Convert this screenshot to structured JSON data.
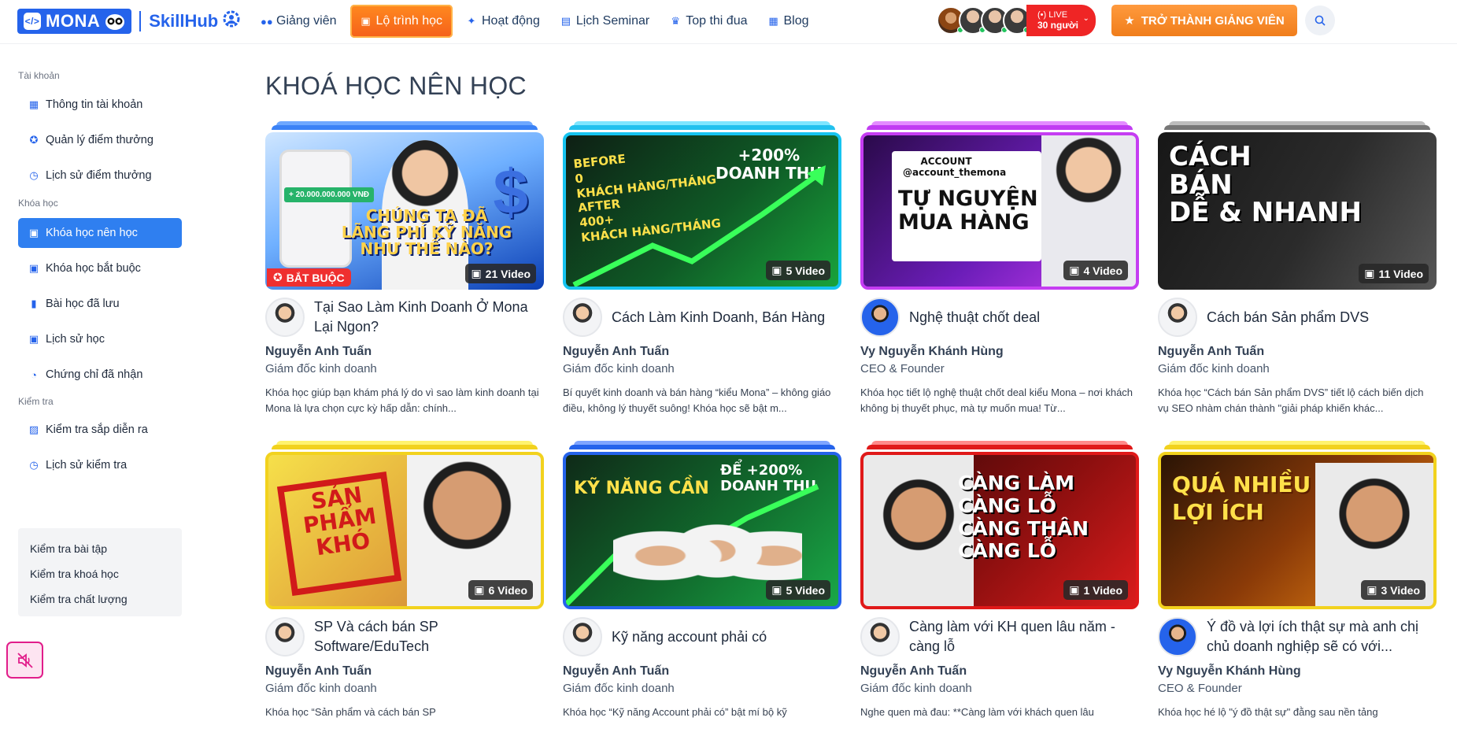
{
  "header": {
    "logo": {
      "brand": "MONA",
      "product": "SkillHub"
    },
    "nav": [
      {
        "label": "Giảng viên",
        "icon": "users-icon"
      },
      {
        "label": "Lộ trình học",
        "icon": "calendar-icon",
        "active": true
      },
      {
        "label": "Hoạt động",
        "icon": "bolt-icon"
      },
      {
        "label": "Lịch Seminar",
        "icon": "seminar-icon"
      },
      {
        "label": "Top thi đua",
        "icon": "trophy-icon"
      },
      {
        "label": "Blog",
        "icon": "blog-icon"
      }
    ],
    "live": {
      "label": "(•) LIVE",
      "count": "30 người"
    },
    "cta": "TRỞ THÀNH GIẢNG VIÊN"
  },
  "sidebar": {
    "sections": [
      {
        "title": "Tài khoản",
        "items": [
          "Thông tin tài khoản",
          "Quản lý điểm thưởng",
          "Lịch sử điểm thưởng"
        ]
      },
      {
        "title": "Khóa học",
        "items": [
          "Khóa học nên học",
          "Khóa học bắt buộc",
          "Bài học đã lưu",
          "Lịch sử học",
          "Chứng chỉ đã nhận"
        ]
      },
      {
        "title": "Kiểm tra",
        "items": [
          "Kiểm tra sắp diễn ra",
          "Lịch sử kiểm tra"
        ]
      }
    ],
    "sub_items": [
      "Kiểm tra bài tập",
      "Kiểm tra khoá học",
      "Kiểm tra chất lượng"
    ]
  },
  "main": {
    "title": "KHOÁ HỌC NÊN HỌC",
    "courses": [
      {
        "title": "Tại Sao Làm Kinh Doanh Ở Mona Lại Ngon?",
        "author": "Nguyễn Anh Tuấn",
        "role": "Giám đốc kinh doanh",
        "desc": "Khóa học giúp bạn khám phá lý do vì sao làm kinh doanh tại Mona là lựa chọn cực kỳ hấp dẫn: chính...",
        "videos": "21 Video",
        "badge": "BẮT BUỘC",
        "thumb_text": "CHÚNG TA ĐÃ\nLÃNG PHÍ KỸ NĂNG\nNHƯ THẾ NÀO?",
        "phone_text": "+ 20.000.000.000 VNĐ"
      },
      {
        "title": "Cách Làm Kinh Doanh, Bán Hàng",
        "author": "Nguyễn Anh Tuấn",
        "role": "Giám đốc kinh doanh",
        "desc": "Bí quyết kinh doanh và bán hàng “kiểu Mona” – không giáo điều, không lý thuyết suông! Khóa học sẽ bật m...",
        "videos": "5 Video",
        "thumb_text": "BEFORE\n0\nKHÁCH HÀNG/THÁNG\nAFTER\n400+\nKHÁCH HÀNG/THÁNG",
        "thumb_text2": "+200%\nDOANH THU"
      },
      {
        "title": "Nghệ thuật chốt deal",
        "author": "Vy Nguyễn Khánh Hùng",
        "role": "CEO & Founder",
        "desc": "Khóa học tiết lộ nghệ thuật chốt deal kiểu Mona – nơi khách không bị thuyết phục, mà tự muốn mua! Từ...",
        "videos": "4 Video",
        "thumb_text": "TỰ NGUYỆN\nMUA HÀNG",
        "thumb_text2": "ACCOUNT\n@account_themona"
      },
      {
        "title": "Cách bán Sản phẩm DVS",
        "author": "Nguyễn Anh Tuấn",
        "role": "Giám đốc kinh doanh",
        "desc": "Khóa học “Cách bán Sản phẩm DVS” tiết lộ cách biến dịch vụ SEO nhàm chán thành \"giải pháp khiến khác...",
        "videos": "11 Video",
        "thumb_text": "CÁCH\nBÁN\nDỄ & NHANH"
      },
      {
        "title": "SP Và cách bán SP Software/EduTech",
        "author": "Nguyễn Anh Tuấn",
        "role": "Giám đốc kinh doanh",
        "desc": "Khóa học “Sản phẩm và cách bán SP",
        "videos": "6 Video",
        "thumb_text": "SẢN\nPHẨM\nKHÓ"
      },
      {
        "title": "Kỹ năng account phải có",
        "author": "Nguyễn Anh Tuấn",
        "role": "Giám đốc kinh doanh",
        "desc": "Khóa học “Kỹ năng Account phải có” bật mí bộ kỹ",
        "videos": "5 Video",
        "thumb_text": "KỸ NĂNG CẦN",
        "thumb_text2": "ĐỂ +200%\nDOANH THU"
      },
      {
        "title": "Càng làm với KH quen lâu năm - càng lỗ",
        "author": "Nguyễn Anh Tuấn",
        "role": "Giám đốc kinh doanh",
        "desc": "Nghe quen mà đau: **Càng làm với khách quen lâu",
        "videos": "1 Video",
        "thumb_text": "CÀNG LÀM\nCÀNG LỖ\nCÀNG THÂN\nCÀNG LỖ"
      },
      {
        "title": "Ý đồ và lợi ích thật sự mà anh chị chủ doanh nghiệp sẽ có với...",
        "author": "Vy Nguyễn Khánh Hùng",
        "role": "CEO & Founder",
        "desc": "Khóa học hé lộ \"ý đồ thật sự\" đằng sau nền tảng",
        "videos": "3 Video",
        "thumb_text": "QUÁ NHIỀU\nLỢI ÍCH"
      }
    ]
  },
  "colors": {
    "accent": "#2563eb",
    "active_nav": "#f5601a",
    "live": "#ef2525",
    "cta": "#f07d1b",
    "sidebar_active": "#2f7ff0",
    "required_badge": "#ef2f2f"
  }
}
